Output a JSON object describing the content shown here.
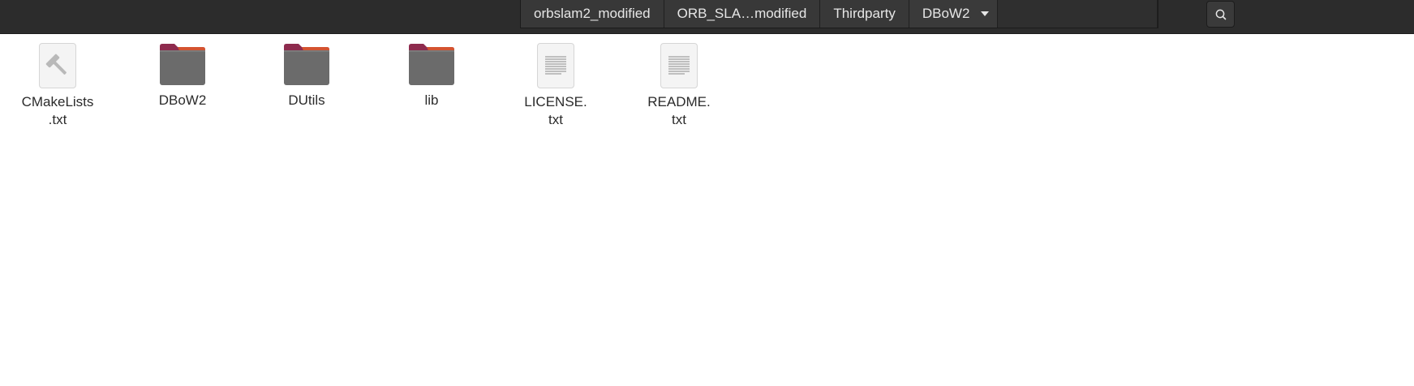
{
  "header": {
    "breadcrumbs": [
      {
        "label": "orbslam2_modified"
      },
      {
        "label": "ORB_SLA…modified"
      },
      {
        "label": "Thirdparty"
      },
      {
        "label": "DBoW2"
      }
    ],
    "search_icon": "search-icon"
  },
  "files": [
    {
      "name": "CMakeLists\n.txt",
      "icon": "build-file-icon",
      "type": "file"
    },
    {
      "name": "DBoW2",
      "icon": "folder-icon",
      "type": "folder"
    },
    {
      "name": "DUtils",
      "icon": "folder-icon",
      "type": "folder"
    },
    {
      "name": "lib",
      "icon": "folder-icon",
      "type": "folder"
    },
    {
      "name": "LICENSE.\ntxt",
      "icon": "text-file-icon",
      "type": "file"
    },
    {
      "name": "README.\ntxt",
      "icon": "text-file-icon",
      "type": "file"
    }
  ],
  "colors": {
    "header_bg": "#2c2c2c",
    "folder_tab": "#8e2b4e",
    "folder_tab_accent": "#e05a2b",
    "folder_body": "#6b6b6b"
  }
}
